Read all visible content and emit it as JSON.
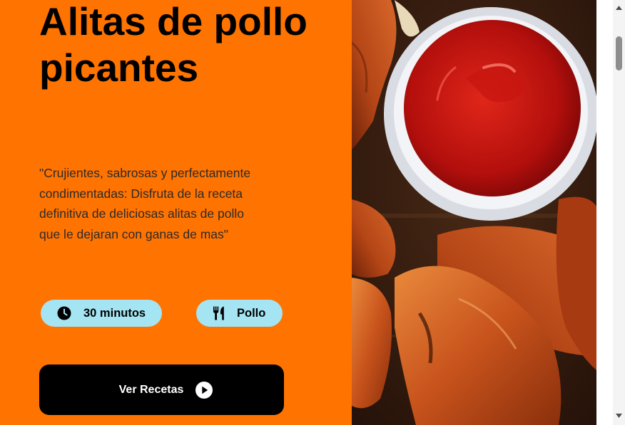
{
  "hero": {
    "title": "Alitas de pollo picantes",
    "description": "\"Crujientes, sabrosas y perfectamente condimentadas: Disfruta de la receta definitiva de deliciosas alitas de pollo que le dejaran con ganas de mas\"",
    "time_label": "30 minutos",
    "time_icon": "clock-icon",
    "category_label": "Pollo",
    "category_icon": "utensils-icon",
    "cta_label": "Ver Recetas",
    "cta_icon": "play-circle-icon"
  },
  "image": {
    "subject": "chicken-wings-with-ketchup-photo"
  },
  "colors": {
    "background": "#ff7300",
    "pill": "#a5e4f3",
    "button": "#000000",
    "text": "#000000"
  }
}
